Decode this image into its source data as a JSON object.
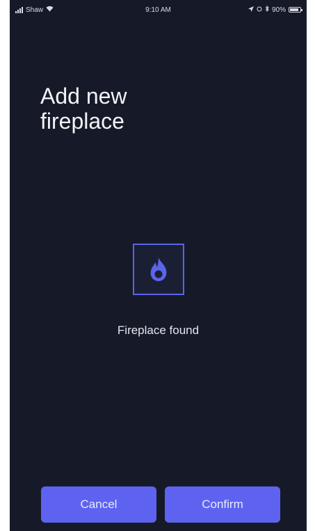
{
  "status_bar": {
    "carrier": "Shaw",
    "time": "9:10 AM",
    "battery": "90%"
  },
  "title": "Add new\nfireplace",
  "found": {
    "icon": "flame-icon",
    "label": "Fireplace found"
  },
  "actions": {
    "cancel_label": "Cancel",
    "confirm_label": "Confirm"
  },
  "colors": {
    "background": "#161a28",
    "accent": "#5d63f0",
    "text": "#f2f3f7"
  }
}
